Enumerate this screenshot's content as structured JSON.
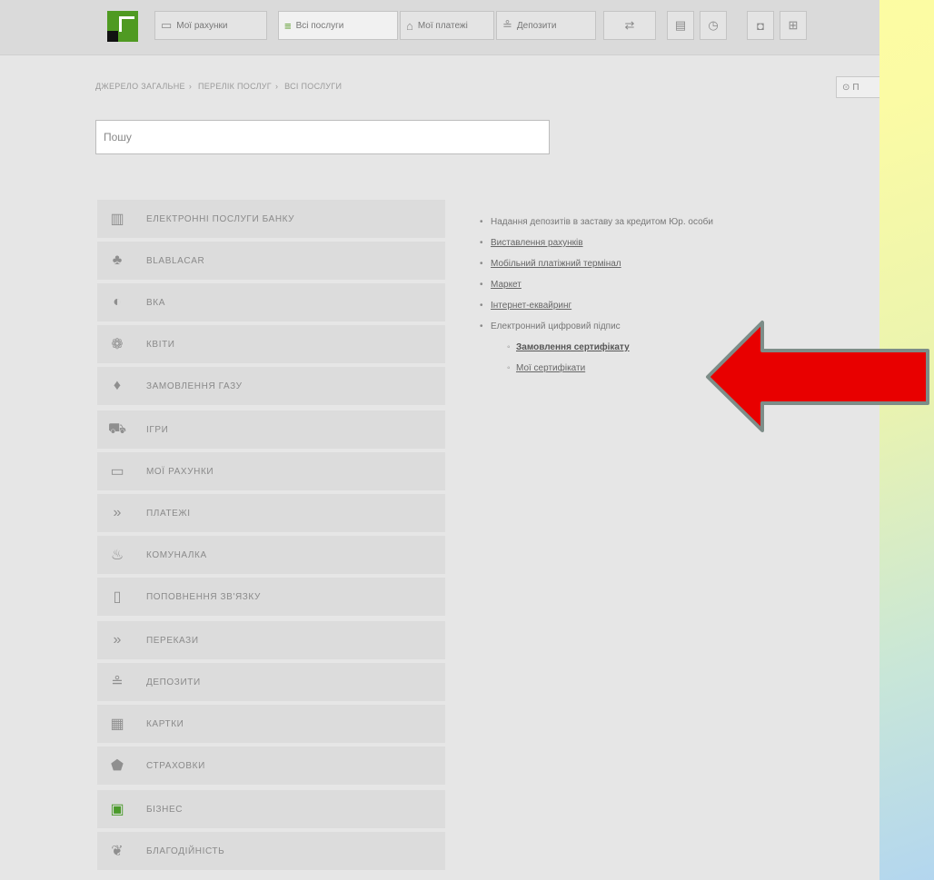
{
  "tabs": [
    {
      "icon": "wallet-icon",
      "glyph": "▭",
      "label": "Мої рахунки"
    },
    {
      "icon": "menu-lines-icon",
      "glyph": "≡",
      "label": "Всі послуги"
    },
    {
      "icon": "home-icon",
      "glyph": "⌂",
      "label": "Мої платежі"
    },
    {
      "icon": "coins-icon",
      "glyph": "≗",
      "label": "Депозити"
    }
  ],
  "icon_buttons": [
    {
      "name": "transfer-icon",
      "glyph": "⇄"
    },
    {
      "name": "document-icon",
      "glyph": "▤"
    },
    {
      "name": "clock-icon",
      "glyph": "◷"
    },
    {
      "name": "camera-icon",
      "glyph": "◘"
    },
    {
      "name": "cart-icon",
      "glyph": "⊞"
    }
  ],
  "breadcrumb": [
    "ДЖЕРЕЛО ЗАГАЛЬНЕ",
    "ПЕРЕЛІК ПОСЛУГ",
    "ВСІ ПОСЛУГИ"
  ],
  "right_button": "П",
  "search": {
    "value": "Пошу"
  },
  "menu": [
    {
      "icon": "building-icon",
      "glyph": "▥",
      "label": "ЕЛЕКТРОННІ ПОСЛУГИ БАНКУ"
    },
    {
      "icon": "people-icon",
      "glyph": "♣",
      "label": "BLABLACAR"
    },
    {
      "icon": "globe-icon",
      "glyph": "◐",
      "label": "ВКА"
    },
    {
      "icon": "puzzle-icon",
      "glyph": "❁",
      "label": "КВІТИ"
    },
    {
      "icon": "drop-icon",
      "glyph": "♦",
      "label": "ЗАМОВЛЕННЯ ГАЗУ"
    },
    {
      "icon": "car-icon",
      "glyph": "⛟",
      "label": "ІГРИ"
    },
    {
      "icon": "card-icon",
      "glyph": "▭",
      "label": "МОЇ РАХУНКИ"
    },
    {
      "icon": "chevrons-icon",
      "glyph": "»",
      "label": "ПЛАТЕЖІ"
    },
    {
      "icon": "faucet-icon",
      "glyph": "♨",
      "label": "КОМУНАЛКА"
    },
    {
      "icon": "phone-icon",
      "glyph": "▯",
      "label": "ПОПОВНЕННЯ ЗВ'ЯЗКУ"
    },
    {
      "icon": "chevrons-icon",
      "glyph": "»",
      "label": "ПЕРЕКАЗИ"
    },
    {
      "icon": "coins-icon",
      "glyph": "≗",
      "label": "ДЕПОЗИТИ"
    },
    {
      "icon": "cards-icon",
      "glyph": "▦",
      "label": "КАРТКИ"
    },
    {
      "icon": "shield-icon",
      "glyph": "⬟",
      "label": "СТРАХОВКИ"
    },
    {
      "icon": "briefcase-icon",
      "glyph": "▣",
      "label": "БІЗНЕС"
    },
    {
      "icon": "heart-hands-icon",
      "glyph": "❦",
      "label": "БЛАГОДІЙНІСТЬ"
    }
  ],
  "links": [
    {
      "label": "Надання депозитів в заставу за кредитом Юр. особи",
      "style": "plain"
    },
    {
      "label": "Виставлення рахунків",
      "style": "underline"
    },
    {
      "label": "Мобільний платіжний термінал",
      "style": "underline"
    },
    {
      "label": "Маркет",
      "style": "underline"
    },
    {
      "label": "Інтернет-еквайринг",
      "style": "underline"
    },
    {
      "label": "Електронний цифровий підпис",
      "style": "plain"
    },
    {
      "label": "Замовлення сертифікату",
      "style": "sub-bold"
    },
    {
      "label": "Мої сертифікати",
      "style": "sub"
    }
  ],
  "colors": {
    "arrow": "#e80000",
    "accent": "#4f9a22"
  }
}
